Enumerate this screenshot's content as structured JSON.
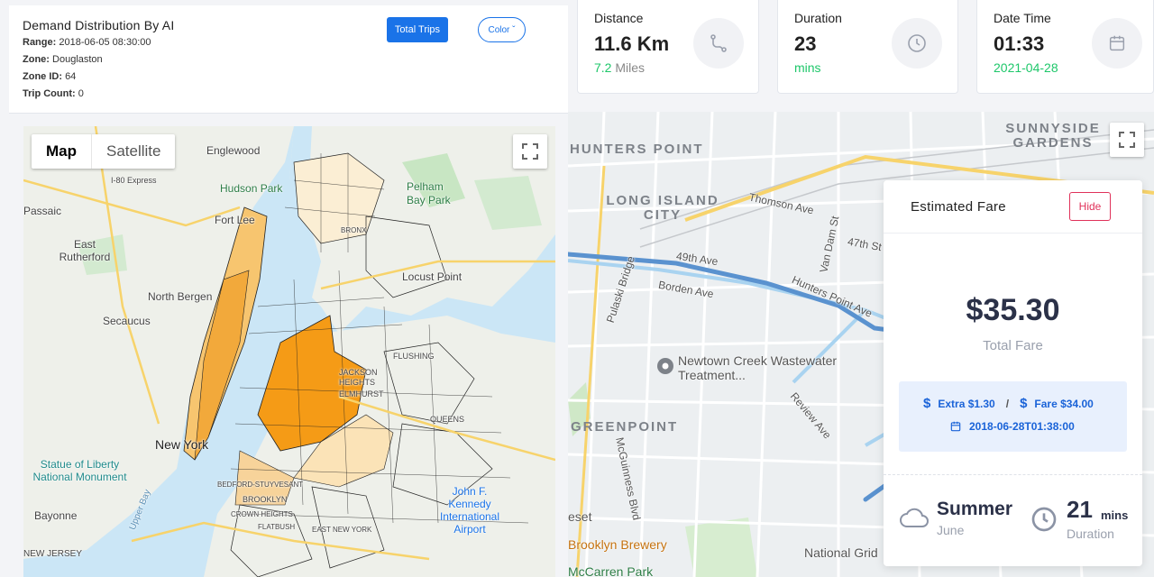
{
  "info": {
    "title": "Demand Distribution By AI",
    "range_label": "Range:",
    "range_value": "2018-06-05 08:30:00",
    "zone_label": "Zone:",
    "zone_value": "Douglaston",
    "zone_id_label": "Zone ID:",
    "zone_id_value": "64",
    "trip_count_label": "Trip Count:",
    "trip_count_value": "0",
    "total_trips_button": "Total Trips",
    "color_button": "Color ˇ"
  },
  "cards": {
    "distance": {
      "label": "Distance",
      "value": "11.6 Km",
      "sub_value": "7.2",
      "sub_unit": "Miles",
      "icon": "route-icon"
    },
    "duration": {
      "label": "Duration",
      "value": "23",
      "sub": "mins",
      "icon": "clock-icon"
    },
    "datetime": {
      "label": "Date Time",
      "value": "01:33",
      "sub": "2021-04-28",
      "icon": "calendar-icon"
    }
  },
  "left_map": {
    "map_type_tabs": [
      "Map",
      "Satellite"
    ],
    "active_tab": "Map",
    "labels": {
      "englewood": "Englewood",
      "hudson_park": "Hudson Park",
      "pelham_bay": "Pelham Bay Park",
      "passaic": "Passaic",
      "fort_lee": "Fort Lee",
      "east_rutherford": "East Rutherford",
      "north_bergen": "North Bergen",
      "secaucus": "Secaucus",
      "locust_point": "Locust Point",
      "flushing": "FLUSHING",
      "jackson_heights": "JACKSON HEIGHTS",
      "elmhurst": "ELMHURST",
      "queens": "QUEENS",
      "new_york": "New York",
      "statue": "Statue of Liberty National Monument",
      "brooklyn": "BROOKLYN",
      "bayonne": "Bayonne",
      "jfk": "John F. Kennedy International Airport",
      "new_jersey": "NEW JERSEY",
      "upper_bay": "Upper Bay",
      "express": "I-80 Express",
      "bronx": "BRONX",
      "bed_stuy": "BEDFORD-STUYVESANT",
      "crown_heights": "CROWN HEIGHTS",
      "flatbush": "FLATBUSH",
      "east_new_york": "EAST NEW YORK"
    }
  },
  "right_map": {
    "labels": {
      "hunters_point": "HUNTERS POINT",
      "sunnyside": "SUNNYSIDE GARDENS",
      "long_island_city": "LONG ISLAND CITY",
      "thomson_ave": "Thomson Ave",
      "pulaski_bridge": "Pulaski Bridge",
      "ave_49th": "49th Ave",
      "borden_ave": "Borden Ave",
      "van_dam": "Van Dam St",
      "hunters_point_ave": "Hunters Point Ave",
      "st_47th": "47th St",
      "newtown_creek": "Newtown Creek Wastewater Treatment...",
      "greenpoint": "GREENPOINT",
      "mcguinness": "McGuinness Blvd",
      "review_ave": "Review Ave",
      "brewery": "Brooklyn Brewery",
      "mccarren": "McCarren Park",
      "national_grid": "National Grid",
      "eset": "eset"
    },
    "fare": {
      "title": "Estimated Fare",
      "hide_button": "Hide",
      "amount": "$35.30",
      "amount_label": "Total Fare",
      "extra": "Extra $1.30",
      "separator": "/",
      "fare": "Fare $34.00",
      "date": "2018-06-28T01:38:00",
      "season": "Summer",
      "season_sub": "June",
      "duration_value": "21",
      "duration_unit": "mins",
      "duration_label": "Duration"
    }
  },
  "colors": {
    "primary": "#1a73e8",
    "green": "#1ec76a",
    "danger": "#e0325a",
    "demand_high": "#f59b16",
    "demand_mid": "#f7c56f",
    "demand_low": "#fbe3b7"
  }
}
